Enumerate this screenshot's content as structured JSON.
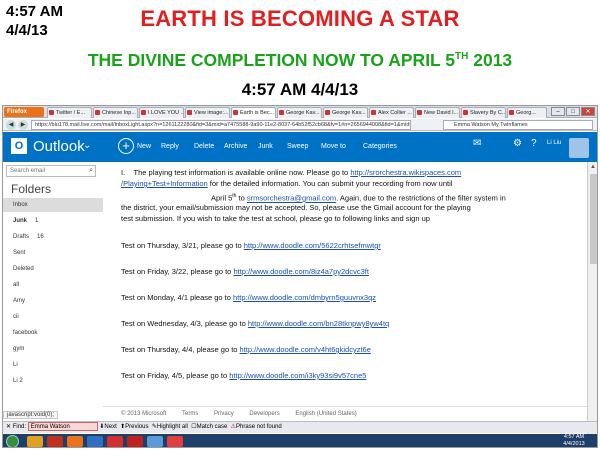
{
  "slide": {
    "time_top_left_line1": "4:57 AM",
    "time_top_left_line2": "4/4/13",
    "headline": "EARTH IS BECOMING A STAR",
    "subline_main": "THE DIVINE COMPLETION NOW TO APRIL 5",
    "subline_sup": "TH",
    "subline_year": " 2013",
    "time_center": "4:57 AM 4/4/13"
  },
  "browser": {
    "app_button": "Firefox",
    "tabs": [
      "Twitter / E...",
      "Chinese Inp...",
      "I LOVE YOU ...",
      "View image:...",
      "Earth is Bec...",
      "George Kav...",
      "George Kav...",
      "Alex Collier ...",
      "New David I...",
      "Slavery By C...",
      "Georg..."
    ],
    "url": "https://blu178.mail.live.com/mail/InboxLight.aspx?n=1261122280&fid=3&mid=a7475588-9a90-11e2-8037-64b52f52cb68&fv=1#n=2656944008&fid=1&mid=ca206420...",
    "search_text": "Emma Watson My Twinflames"
  },
  "outlook": {
    "title": "Outlook",
    "commands": [
      "New",
      "Reply",
      "Delete",
      "Archive",
      "Junk",
      "Sweep",
      "Move to",
      "Categories"
    ],
    "user": "Li Liu"
  },
  "sidebar": {
    "search_placeholder": "Search email",
    "folders_heading": "Folders",
    "items": [
      {
        "label": "Inbox",
        "count": ""
      },
      {
        "label": "Junk",
        "count": "1"
      },
      {
        "label": "Drafts",
        "count": "16"
      },
      {
        "label": "Sent",
        "count": ""
      },
      {
        "label": "Deleted",
        "count": ""
      },
      {
        "label": "all",
        "count": ""
      },
      {
        "label": "Amy",
        "count": ""
      },
      {
        "label": "cii",
        "count": ""
      },
      {
        "label": "facebook",
        "count": ""
      },
      {
        "label": "gym",
        "count": ""
      },
      {
        "label": "Li",
        "count": ""
      },
      {
        "label": "Li 2",
        "count": ""
      }
    ]
  },
  "message": {
    "item_number": "I.",
    "line1_pre": "The playing test information is available online now.  Please go to ",
    "line1_link": "http://srorchestra.wikispaces.com",
    "line2_link": "/Playing+Test+Information",
    "line2_post": " for the detailed information.  You can submit your recording from now until",
    "line3_pre": "April 5",
    "line3_sup": "th",
    "line3_mid": " to ",
    "line3_link": "srmsorchestra@gmail.com",
    "line3_post": ".  Again, due to the restrictions of the filter system in",
    "line4": "the district, your email/submission may not be accepted.  So, please use the Gmail account for the playing",
    "line5": "test submission.  If you wish to take the test at school, please go to following links and sign up",
    "tests": [
      {
        "pre": "Test on Thursday, 3/21, please go to ",
        "link": "http://www.doodle.com/5622crhtsefmwtgr"
      },
      {
        "pre": "Test on Friday, 3/22, please go to ",
        "link": "http://www.doodle.com/8iz4a7py2dcvc3ft"
      },
      {
        "pre": "Test on Monday, 4/1 please go to ",
        "link": "http://www.doodle.com/dmbyrn5guuvnx3qz"
      },
      {
        "pre": "Test on Wednesday, 4/3, please go to ",
        "link": "http://www.doodle.com/bn28tknpwy8yw4tq"
      },
      {
        "pre": "Test on Thursday, 4/4, please go to ",
        "link": "http://www.doodle.com/v4ht6gkidcyzt6e"
      },
      {
        "pre": "Test on Friday, 4/5, please go to ",
        "link": "http://www.doodle.com/i3ky93si9v57cne5"
      }
    ]
  },
  "footer": {
    "items": [
      "© 2013 Microsoft",
      "Terms",
      "Privacy",
      "Developers",
      "English (United States)"
    ]
  },
  "statusbar": {
    "js": "javascript:void(0);"
  },
  "findbar": {
    "label": "Find:",
    "value": "Emma Watson",
    "next": "Next",
    "previous": "Previous",
    "highlight": "Highlight all",
    "matchcase": "Match case",
    "notfound": "Phrase not found"
  },
  "taskbar": {
    "time": "4:57 AM",
    "date": "4/4/2013"
  },
  "colors": {
    "headline": "#e02020",
    "subline": "#1aa31a",
    "outlook_blue": "#0072c6",
    "link": "#1a4fb0"
  }
}
